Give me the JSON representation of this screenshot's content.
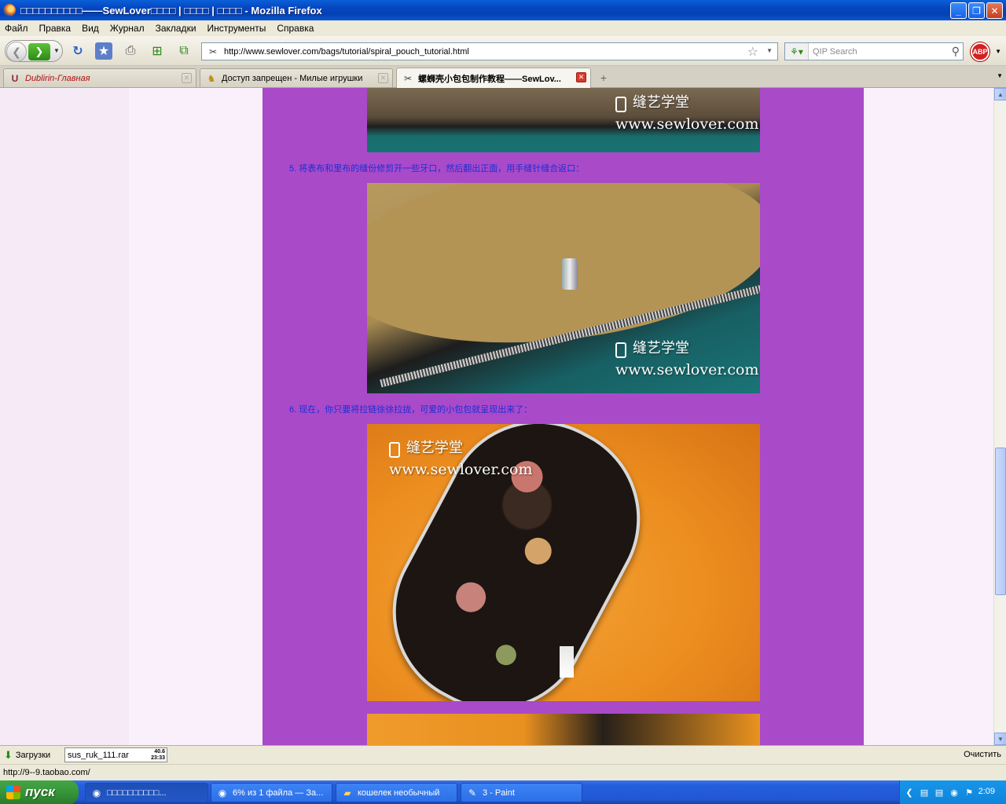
{
  "window": {
    "title": "□□□□□□□□□□——SewLover□□□□ | □□□□ | □□□□ - Mozilla Firefox",
    "minimize": "_",
    "restore": "❐",
    "close": "✕"
  },
  "menu": [
    "Файл",
    "Правка",
    "Вид",
    "Журнал",
    "Закладки",
    "Инструменты",
    "Справка"
  ],
  "toolbar": {
    "back_icon": "❮",
    "forward_icon": "❯",
    "url": "http://www.sewlover.com/bags/tutorial/spiral_pouch_tutorial.html",
    "search_placeholder": "QIP Search",
    "abp_label": "ABP"
  },
  "tabs": [
    {
      "label": "Dublirin-Главная",
      "active": false
    },
    {
      "label": "Доступ запрещен - Милые игрушки",
      "active": false
    },
    {
      "label": "螺蛳壳小包包制作教程——SewLov...",
      "active": true
    }
  ],
  "page": {
    "step5": "5. 将表布和里布的缝份修剪开一些牙口，然后翻出正面，用手缝针缝合返口：",
    "step6": "6. 现在，你只要将拉链徐徐拉拢，可爱的小包包就呈现出来了：",
    "watermark_cn": "缝艺学堂",
    "watermark_en": "www.sewlover.com"
  },
  "downloads": {
    "label": "Загрузки",
    "file": "sus_ruk_111.rar",
    "size": "40.6",
    "time": "23:33",
    "clear": "Очистить"
  },
  "status": {
    "text": "http://9--9.taobao.com/"
  },
  "taskbar": {
    "start": "пуск",
    "tasks": [
      {
        "label": "□□□□□□□□□□...",
        "active": true
      },
      {
        "label": "6% из 1 файла — За...",
        "active": false
      },
      {
        "label": "кошелек необычный",
        "active": false
      },
      {
        "label": "3 - Paint",
        "active": false
      }
    ],
    "clock": "2:09"
  }
}
